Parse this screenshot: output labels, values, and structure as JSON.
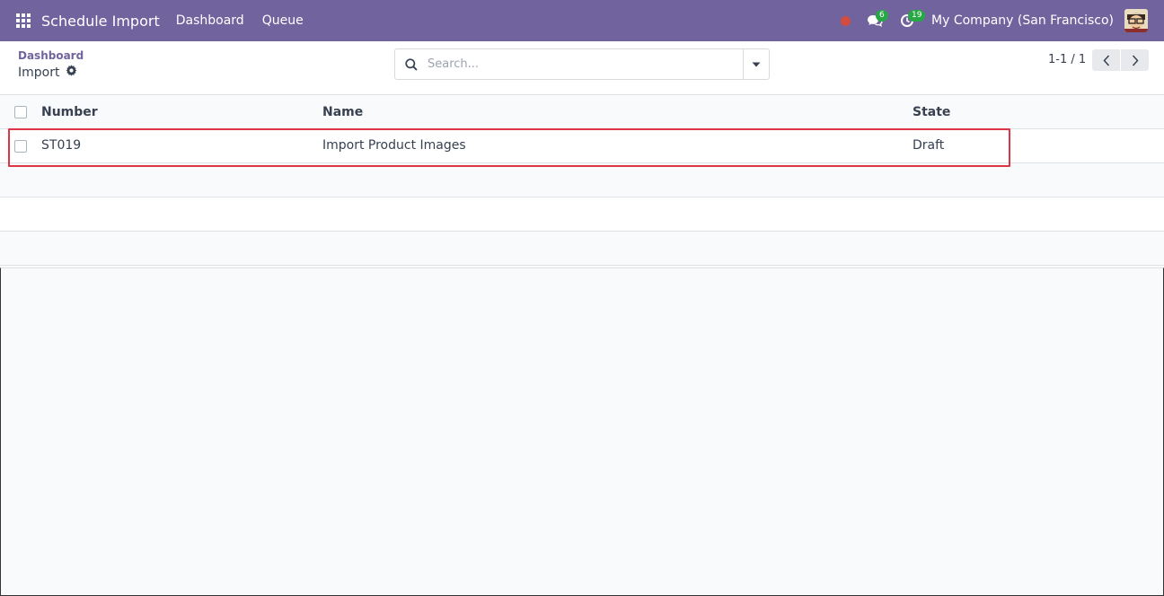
{
  "navbar": {
    "app_title": "Schedule Import",
    "links": [
      "Dashboard",
      "Queue"
    ],
    "messages_badge": "6",
    "activities_badge": "19",
    "company": "My Company (San Francisco)",
    "bg_color": "#71639e"
  },
  "control": {
    "breadcrumb_parent": "Dashboard",
    "breadcrumb_current": "Import",
    "search_placeholder": "Search...",
    "pager_value": "1-1 / 1"
  },
  "table": {
    "columns": [
      "Number",
      "Name",
      "State"
    ],
    "rows": [
      {
        "number": "ST019",
        "name": "Import Product Images",
        "state": "Draft"
      }
    ]
  },
  "icons": {
    "apps": "apps-grid-icon",
    "search": "search-icon",
    "dropdown": "caret-down-icon",
    "settings": "gear-icon",
    "messages": "chat-icon",
    "activities": "clock-icon",
    "record": "record-dot-icon"
  },
  "colors": {
    "highlight": "#dc3545",
    "badge": "#28a745",
    "record": "#d44c40"
  }
}
